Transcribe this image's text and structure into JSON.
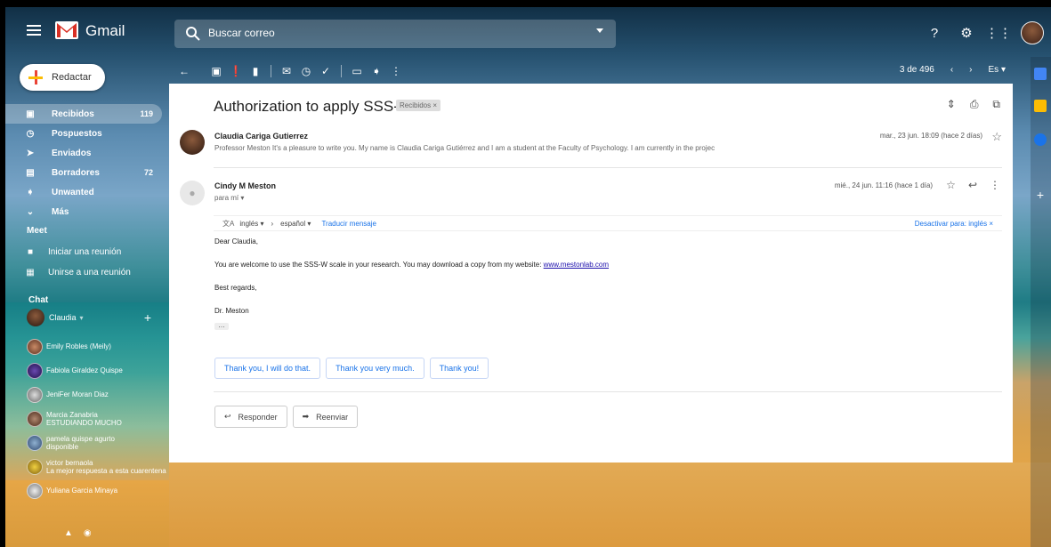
{
  "app": {
    "name": "Gmail"
  },
  "search": {
    "placeholder": "Buscar correo"
  },
  "compose": {
    "label": "Redactar"
  },
  "nav": [
    {
      "label": "Recibidos",
      "count": "119",
      "icon": "inbox-icon",
      "active": true
    },
    {
      "label": "Pospuestos",
      "count": "",
      "icon": "clock-icon"
    },
    {
      "label": "Enviados",
      "count": "",
      "icon": "send-icon"
    },
    {
      "label": "Borradores",
      "count": "72",
      "icon": "draft-icon"
    },
    {
      "label": "Unwanted",
      "count": "",
      "icon": "label-icon"
    },
    {
      "label": "Más",
      "count": "",
      "icon": "chevron-down-icon"
    }
  ],
  "meet": {
    "title": "Meet",
    "items": [
      "Iniciar una reunión",
      "Unirse a una reunión"
    ]
  },
  "chat": {
    "title": "Chat",
    "me": "Claudia",
    "contacts": [
      {
        "name": "Emily Robles (Meily)",
        "status": ""
      },
      {
        "name": "Fabiola Giraldez Quispe",
        "status": ""
      },
      {
        "name": "JeniFer Moran Diaz",
        "status": ""
      },
      {
        "name": "Marcia Zanabria",
        "status": "ESTUDIANDO MUCHO"
      },
      {
        "name": "pamela quispe agurto",
        "status": "disponible"
      },
      {
        "name": "victor bernaola",
        "status": "La mejor respuesta a esta cuarentena"
      },
      {
        "name": "Yuliana Garcia Minaya",
        "status": ""
      }
    ]
  },
  "toolbar": {
    "pagination": "3 de 496",
    "lang": "Es"
  },
  "email": {
    "subject": "Authorization to apply SSS-W",
    "label": "Recibidos",
    "msg1": {
      "from": "Claudia Cariga Gutierrez",
      "snippet": "Professor Meston It's a pleasure to write you. My name is Claudia Cariga Gutiérrez and I am a student at the Faculty of Psychology. I am currently in the projec",
      "date": "mar., 23 jun. 18:09 (hace 2 días)"
    },
    "msg2": {
      "from": "Cindy M Meston",
      "to": "para mí",
      "date": "mié., 24 jun. 11:16 (hace 1 día)",
      "translate_from": "inglés",
      "translate_to": "español",
      "translate_link": "Traducir mensaje",
      "translate_off": "Desactivar para: inglés",
      "greeting": "Dear Claudia,",
      "body_text": "You are welcome to use the SSS-W scale in your research. You may download a copy from my website: ",
      "body_link": "www.mestonlab.com",
      "closing": "Best regards,",
      "signature": "Dr. Meston"
    },
    "smart_replies": [
      "Thank you, I will do that.",
      "Thank you very much.",
      "Thank you!"
    ],
    "reply_label": "Responder",
    "forward_label": "Reenviar"
  }
}
